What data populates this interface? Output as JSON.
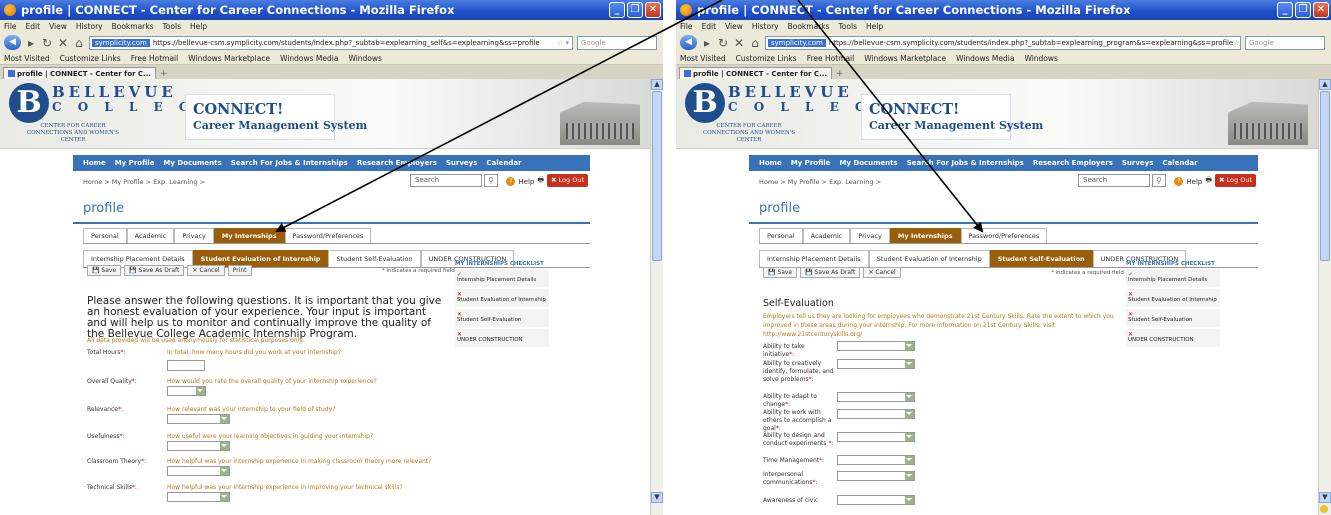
{
  "menu": [
    "File",
    "Edit",
    "View",
    "History",
    "Bookmarks",
    "Tools",
    "Help"
  ],
  "bookmarks": [
    "Most Visited",
    "Customize Links",
    "Free Hotmail",
    "Windows Marketplace",
    "Windows Media",
    "Windows"
  ],
  "tab_title": "profile | CONNECT - Center for C...",
  "nav_items": [
    "Home",
    "My Profile",
    "My Documents",
    "Search For Jobs & Internships",
    "Research Employers",
    "Surveys",
    "Calendar"
  ],
  "college": {
    "name1": "BELLEVUE",
    "name2": "C O L L E G E",
    "sub": "CENTER FOR CAREER CONNECTIONS AND WOMEN'S CENTER",
    "logo_letter": "B"
  },
  "connect": {
    "title": "CONNECT!",
    "subtitle": "Career Management System"
  },
  "breadcrumb": "Home > My Profile > Exp. Learning >",
  "search_placeholder": "Search",
  "help": "Help",
  "logout": "Log Out",
  "page_title": "profile",
  "profile_tabs": [
    "Personal",
    "Academic",
    "Privacy",
    "My Internships",
    "Password/Preferences"
  ],
  "left": {
    "window_title": "profile | CONNECT - Center for Career Connections - Mozilla Firefox",
    "url_site": "symplicity.com",
    "url": "https://bellevue-csm.symplicity.com/students/index.php?_subtab=explearning_self&s=explearning&ss=profile",
    "search_engine": "Google",
    "sub_tabs": [
      "Internship Placement Details",
      "Student Evaluation of Internship",
      "Student Self-Evaluation",
      "UNDER CONSTRUCTION"
    ],
    "buttons": [
      "Save",
      "Save As Draft",
      "Cancel",
      "Print"
    ],
    "required_note": "* indicates a required field",
    "intro": "Please answer the following questions. It is important that you give an honest evaluation of your experience. Your input is important and will help us to monitor and continually improve the quality of the Bellevue College Academic Internship Program.",
    "anon_note": "All data provided will be used anonymously for statistical purposes only.",
    "questions": [
      {
        "label": "Total Hours",
        "text": "In total, how many hours did you work at your internship?"
      },
      {
        "label": "Overall Quality",
        "text": "How would you rate the overall quality of your internship experience?"
      },
      {
        "label": "Relevance",
        "text": "How relevant was your internship to your field of study?"
      },
      {
        "label": "Usefulness",
        "text": "How useful were your learning objectives in guiding your internship?"
      },
      {
        "label": "Classroom Theory",
        "text": "How helpful was your internship experience in making classroom theory more relevant?"
      },
      {
        "label": "Technical Skills",
        "text": "How helpful was your internship experience in improving your technical skills?"
      }
    ]
  },
  "right": {
    "window_title": "profile | CONNECT - Center for Career Connections - Mozilla Firefox",
    "url_site": "symplicity.com",
    "url": "https://bellevue-csm.symplicity.com/students/index.php?_subtab=explearning_program&s=explearning&ss=profile",
    "search_engine": "Google",
    "sub_tabs": [
      "Internship Placement Details",
      "Student Evaluation of Internship",
      "Student Self-Evaluation",
      "UNDER CONSTRUCTION"
    ],
    "buttons": [
      "Save",
      "Save As Draft",
      "Cancel"
    ],
    "required_note": "* indicates a required field",
    "heading": "Self-Evaluation",
    "desc": "Employers tell us they are looking for employees who demonstrate 21st Century Skills. Rate the extent to which you improved in these areas during your internship. For more information on 21st Century Skills, visit http://www.21stcenturyskills.org/",
    "questions": [
      "Ability to take initiative",
      "Ability to creatively identify, formulate, and solve problems",
      "Ability to adapt to change",
      "Ability to work with others to accomplish a goal",
      "Ability to design and conduct experiments",
      "Time Management",
      "Interpersonal communications",
      "Awareness of civic"
    ]
  },
  "checklist": {
    "title": "MY INTERNSHIPS CHECKLIST",
    "items": [
      "Internship Placement Details",
      "Student Evaluation of Internship",
      "Student Self-Evaluation",
      "UNDER CONSTRUCTION"
    ],
    "left_marks": [
      "✓",
      "✕",
      "✕",
      "✕"
    ],
    "right_marks": [
      "✓",
      "✕",
      "✕",
      "✕"
    ]
  }
}
